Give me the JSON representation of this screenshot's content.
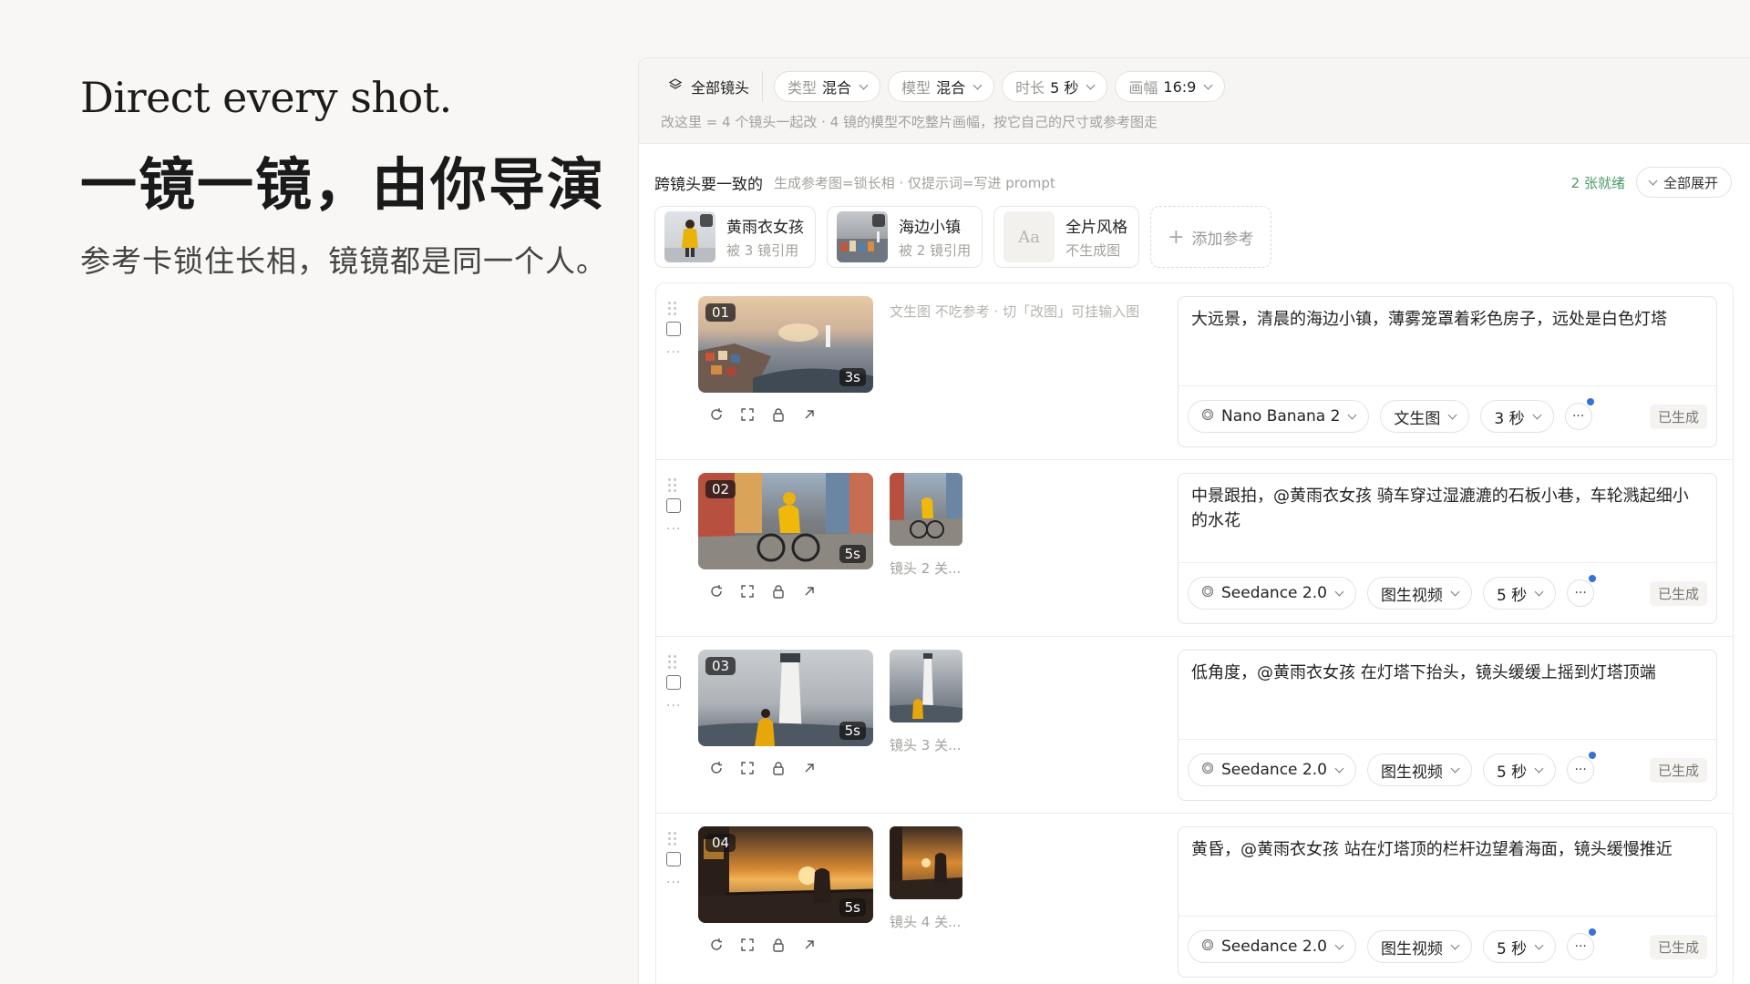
{
  "hero": {
    "title_en": "Direct every shot.",
    "title_zh": "一镜一镜，由你导演",
    "subtitle": "参考卡锁住长相，镜镜都是同一个人。"
  },
  "toolbar": {
    "all_shots": "全部镜头",
    "filters": [
      {
        "key": "类型",
        "value": "混合"
      },
      {
        "key": "模型",
        "value": "混合"
      },
      {
        "key": "时长",
        "value": "5 秒"
      },
      {
        "key": "画幅",
        "value": "16:9"
      }
    ],
    "note": "改这里 = 4 个镜头一起改 · 4 镜的模型不吃整片画幅，按它自己的尺寸或参考图走"
  },
  "refs": {
    "title": "跨镜头要一致的",
    "hint": "生成参考图=锁长相 · 仅提示词=写进 prompt",
    "ready": "2 张就绪",
    "expand": "全部展开",
    "cards": [
      {
        "name": "黄雨衣女孩",
        "meta": "被 3 镜引用"
      },
      {
        "name": "海边小镇",
        "meta": "被 2 镜引用"
      },
      {
        "name": "全片风格",
        "meta": "不生成图",
        "glyph": "Aa"
      }
    ],
    "add": "添加参考"
  },
  "shots": [
    {
      "num": "01",
      "dur": "3s",
      "ref_hint": "文生图 不吃参考 · 切「改图」可挂输入图",
      "ref_label": "",
      "prompt": "大远景，清晨的海边小镇，薄雾笼罩着彩色房子，远处是白色灯塔",
      "model": "Nano Banana 2",
      "mode": "文生图",
      "length": "3 秒",
      "status": "已生成"
    },
    {
      "num": "02",
      "dur": "5s",
      "ref_hint": "",
      "ref_label": "镜头 2 关...",
      "prompt": "中景跟拍，@黄雨衣女孩 骑车穿过湿漉漉的石板小巷，车轮溅起细小的水花",
      "model": "Seedance 2.0",
      "mode": "图生视频",
      "length": "5 秒",
      "status": "已生成"
    },
    {
      "num": "03",
      "dur": "5s",
      "ref_hint": "",
      "ref_label": "镜头 3 关...",
      "prompt": "低角度，@黄雨衣女孩 在灯塔下抬头，镜头缓缓上摇到灯塔顶端",
      "model": "Seedance 2.0",
      "mode": "图生视频",
      "length": "5 秒",
      "status": "已生成"
    },
    {
      "num": "04",
      "dur": "5s",
      "ref_hint": "",
      "ref_label": "镜头 4 关...",
      "prompt": "黄昏，@黄雨衣女孩 站在灯塔顶的栏杆边望着海面，镜头缓慢推近",
      "model": "Seedance 2.0",
      "mode": "图生视频",
      "length": "5 秒",
      "status": "已生成"
    }
  ]
}
